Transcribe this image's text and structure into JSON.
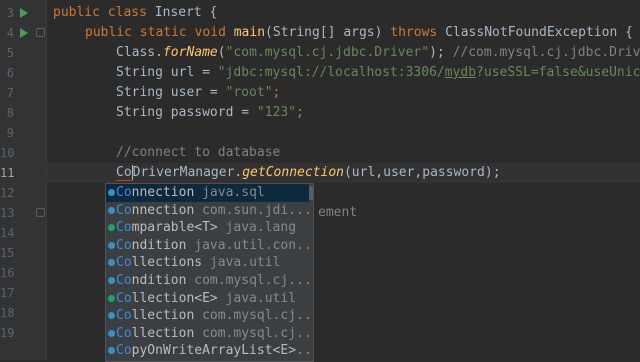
{
  "colors": {
    "background": "#2b2b2b",
    "keyword": "#cc7832",
    "method": "#ffc66d",
    "string": "#6a8759",
    "comment": "#808080",
    "popup_background": "#3c3f41",
    "match_highlight": "#3d8bd8",
    "class_icon": "#3592c4",
    "enum_icon": "#1aa36f"
  },
  "gutter": {
    "line_numbers": [
      "3",
      "4",
      "5",
      "6",
      "7",
      "8",
      "9",
      "10",
      "11",
      "12",
      "13",
      "14",
      "15",
      "16",
      "17",
      "18",
      "19"
    ],
    "active_line": "11",
    "run_icons": [
      "run-icon",
      "run-icon"
    ]
  },
  "code": {
    "line3": {
      "kw1": "public",
      "kw2": "class",
      "name": "Insert {"
    },
    "line4": {
      "kw1": "public",
      "kw2": "static",
      "kw3": "void",
      "fn": "main",
      "params": "(String[] args) ",
      "kw4": "throws",
      "exc": "ClassNotFoundException {"
    },
    "line5": {
      "obj": "Class.",
      "fn": "forName",
      "open": "(",
      "str": "\"com.mysql.cj.jdbc.Driver\"",
      "close": "); ",
      "comment": "//com.mysql.cj.jdbc.Driver"
    },
    "line6": {
      "decl": "String url = ",
      "str1": "\"jdbc:mysql://localhost:3306/",
      "str2": "mydb",
      "str3": "?useSSL=false&useUnicod"
    },
    "line7": {
      "decl": "String user = ",
      "str": "\"root\"",
      "end": ";"
    },
    "line8": {
      "decl": "String password = ",
      "str": "\"123\"",
      "end": ";"
    },
    "line10": {
      "comment": "//connect to database"
    },
    "line11": {
      "typed": "Co",
      "cls": "DriverManager.",
      "fn": "getConnection",
      "args": "(url,user,password);"
    },
    "line13_hint": "ement"
  },
  "completion_popup": {
    "icons": [
      "class-icon",
      "class-icon",
      "interface-icon",
      "class-icon",
      "class-icon",
      "class-icon",
      "class-icon",
      "class-icon",
      "class-icon",
      "class-icon"
    ],
    "items": [
      {
        "match": "Co",
        "name": "nnection",
        "package": " java.sql"
      },
      {
        "match": "Co",
        "name": "nnection",
        "package": " com.sun.jdi..."
      },
      {
        "match": "Co",
        "name": "mparable<T>",
        "package": " java.lang"
      },
      {
        "match": "Co",
        "name": "ndition",
        "package": " java.util.con..."
      },
      {
        "match": "Co",
        "name": "llections",
        "package": " java.util"
      },
      {
        "match": "Co",
        "name": "ndition",
        "package": " com.mysql.cj..."
      },
      {
        "match": "Co",
        "name": "llection<E>",
        "package": " java.util"
      },
      {
        "match": "Co",
        "name": "llection",
        "package": " com.mysql.cj..."
      },
      {
        "match": "Co",
        "name": "llection",
        "package": " com.mysql.cj..."
      },
      {
        "match": "Co",
        "name": "pyOnWriteArrayList<E>",
        "package": "..."
      }
    ]
  }
}
